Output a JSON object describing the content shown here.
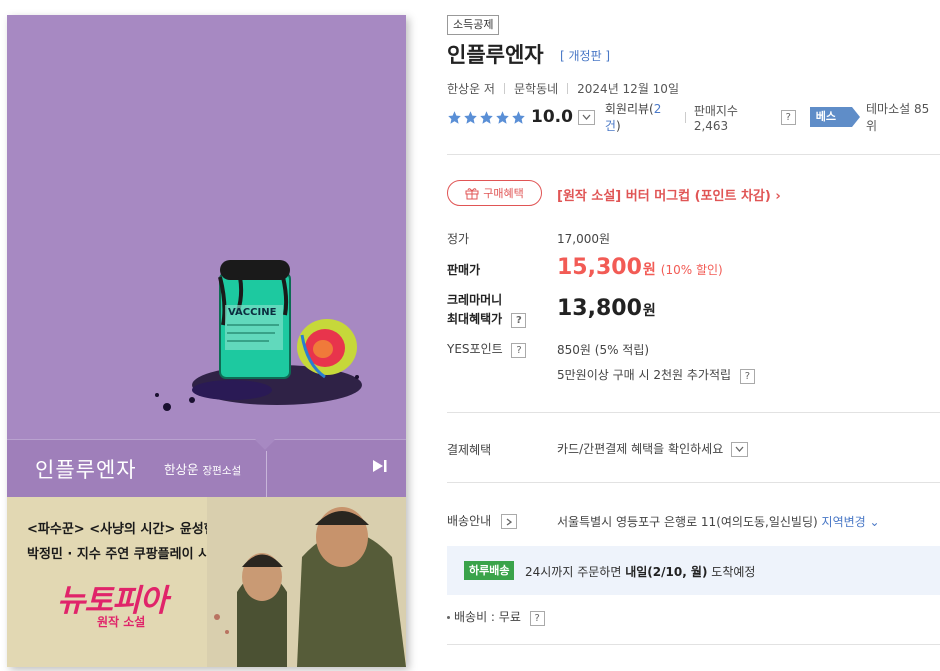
{
  "cover": {
    "title": "인플루엔자",
    "author": "한상운",
    "author_suffix": "장편소설",
    "art_text": "VACCINE",
    "banner_line1": "<파수꾼> <사냥의 시간> 윤성현 감독",
    "banner_line2": "박정민 · 지수 주연 쿠팡플레이 시리즈",
    "banner_logo": "뉴토피아",
    "banner_sub": "원작 소설",
    "bg_color": "#a789c2"
  },
  "product": {
    "badge": "소득공제",
    "title": "인플루엔자",
    "edition": "[ 개정판 ]",
    "author": "한상운 저",
    "publisher": "문학동네",
    "date": "2024년 12월 10일",
    "stars": 5,
    "score": "10.0",
    "review_label": "회원리뷰(",
    "review_count": "2건",
    "review_close": ")",
    "sales_label": "판매지수 2,463",
    "best_label": "베스트",
    "theme_rank": "테마소설 85위"
  },
  "benefit": {
    "pill_label": "구매혜택",
    "link_text": "[원작 소설] 버터 머그컵 (포인트 차감) ›"
  },
  "price": {
    "list_label": "정가",
    "list_value": "17,000원",
    "sale_label": "판매가",
    "sale_value": "15,300",
    "sale_unit": "원",
    "sale_discount": "(10% 할인)",
    "crema_label_1": "크레마머니",
    "crema_label_2": "최대혜택가",
    "crema_value": "13,800",
    "crema_unit": "원",
    "point_label": "YES포인트",
    "point_value": "850원 (5% 적립)",
    "point_extra": "5만원이상 구매 시 2천원 추가적립",
    "help_mark": "?"
  },
  "payment": {
    "label": "결제혜택",
    "value": "카드/간편결제 혜택을 확인하세요"
  },
  "delivery": {
    "label": "배송안내",
    "address": "서울특별시 영등포구 은행로 11(여의도동,일신빌딩)",
    "region_change": "지역변경",
    "today_tag": "하루배송",
    "today_pre": "24시까지 주문하면",
    "today_bold": "내일(2/10, 월)",
    "today_post": "도착예정",
    "fee_text": "배송비 : 무료"
  },
  "colors": {
    "accent_red": "#f25b55",
    "link_blue": "#4a78c6",
    "best_blue": "#5f8dc8",
    "today_green": "#3aa34a",
    "star_blue": "#5a8fd6"
  }
}
